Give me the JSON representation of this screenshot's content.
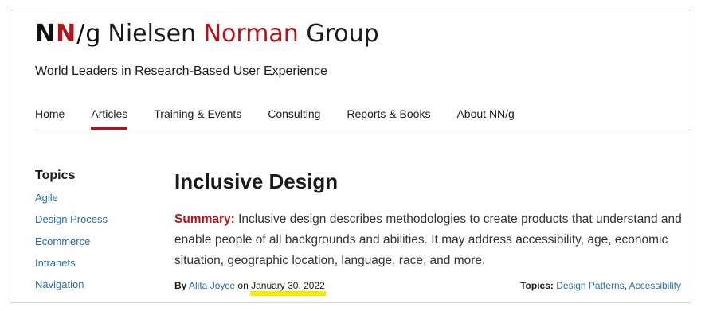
{
  "logo": {
    "mark_n1": "N",
    "mark_n2": "N",
    "mark_slash": "/",
    "mark_g": "g",
    "name_part1": "Nielsen",
    "name_part2": "Norman",
    "name_part3": "Group"
  },
  "tagline": "World Leaders in Research-Based User Experience",
  "nav": {
    "items": [
      {
        "label": "Home"
      },
      {
        "label": "Articles"
      },
      {
        "label": "Training & Events"
      },
      {
        "label": "Consulting"
      },
      {
        "label": "Reports & Books"
      },
      {
        "label": "About NN/g"
      }
    ],
    "active": "Articles"
  },
  "sidebar": {
    "heading": "Topics",
    "items": [
      {
        "label": "Agile"
      },
      {
        "label": "Design Process"
      },
      {
        "label": "Ecommerce"
      },
      {
        "label": "Intranets"
      },
      {
        "label": "Navigation"
      }
    ]
  },
  "article": {
    "title": "Inclusive Design",
    "summary_label": "Summary:",
    "summary_text": "Inclusive design describes methodologies to create products that understand and enable people of all backgrounds and abilities. It may address accessibility, age, economic situation, geographic location, language, race, and more.",
    "by_label": "By",
    "author": "Alita Joyce",
    "on_label": "on",
    "date": "January 30, 2022",
    "topics_label": "Topics:",
    "topics": [
      {
        "label": "Design Patterns"
      },
      {
        "label": "Accessibility"
      }
    ],
    "topics_separator": ","
  },
  "colors": {
    "brand_red": "#b3121a",
    "link_blue": "#2a6fa6",
    "highlight_yellow": "#f5e900"
  }
}
